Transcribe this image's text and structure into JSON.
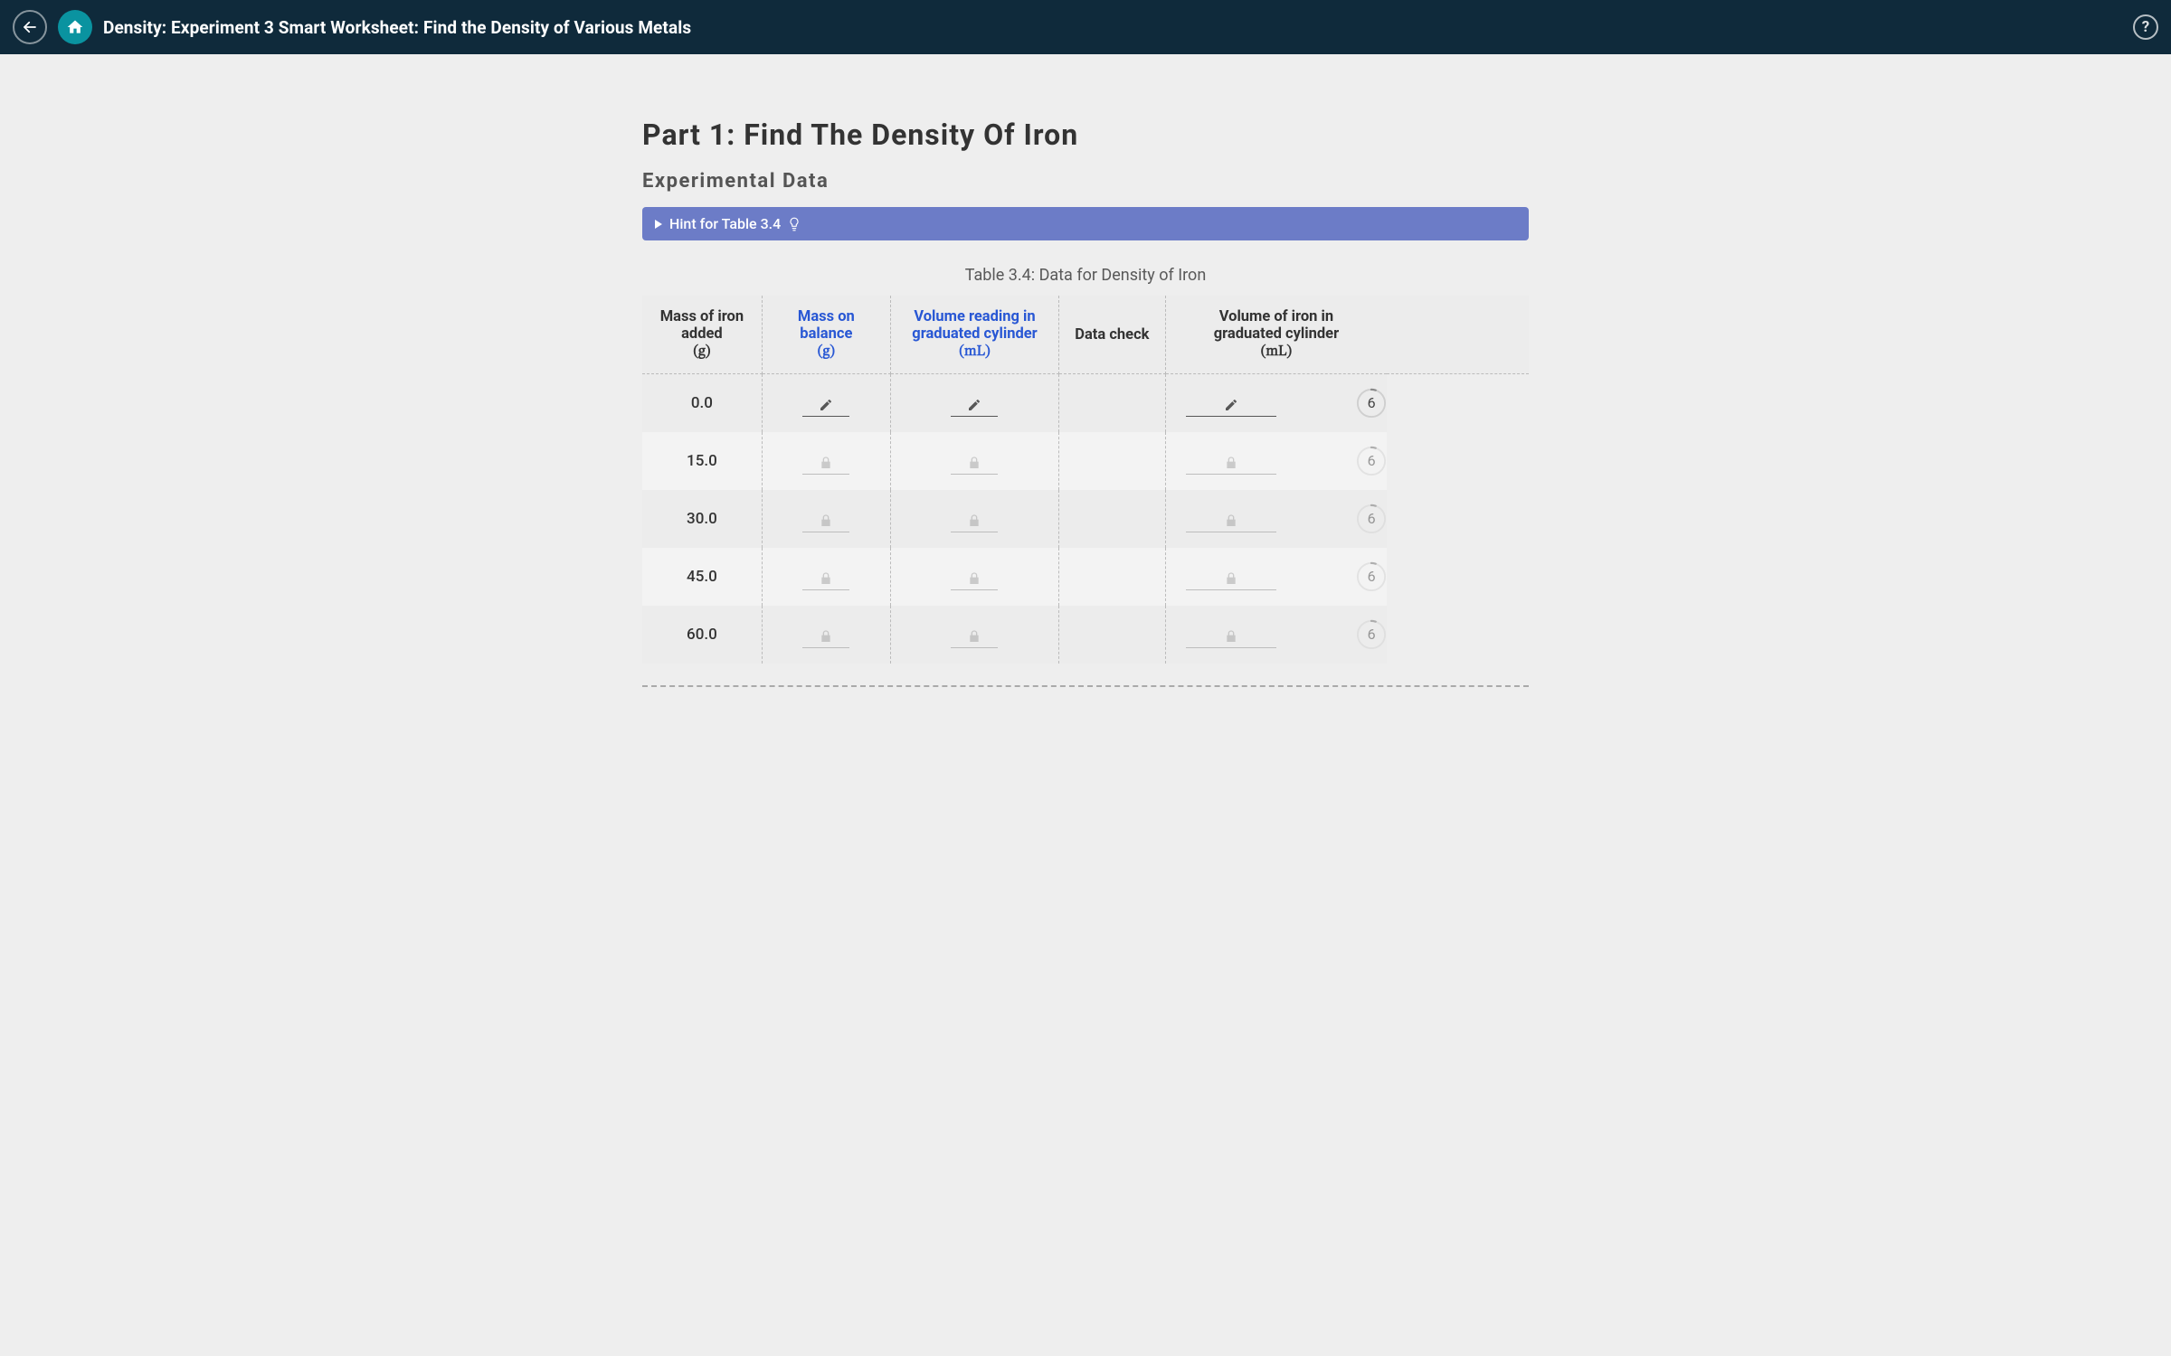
{
  "appbar": {
    "title": "Density: Experiment 3 Smart Worksheet: Find the Density of Various Metals",
    "help_label": "?",
    "back_icon": "arrow-left-icon",
    "home_icon": "home-icon"
  },
  "part_title": "Part 1: Find The Density Of Iron",
  "section_title": "Experimental Data",
  "hint": {
    "label": "Hint for Table 3.4"
  },
  "table": {
    "caption": "Table 3.4: Data for Density of Iron",
    "headers": {
      "col1_line1": "Mass of iron",
      "col1_line2": "added",
      "col1_unit": "(g)",
      "col2_line1": "Mass on",
      "col2_line2": "balance",
      "col2_unit": "(g)",
      "col3_line1": "Volume reading in",
      "col3_line2": "graduated cylinder",
      "col3_unit": "(mL)",
      "col4": "Data check",
      "col5_line1": "Volume of iron in",
      "col5_line2": "graduated cylinder",
      "col5_unit": "(mL)"
    },
    "rows": [
      {
        "mass_added": "0.0",
        "state": "editable",
        "attempts": "6"
      },
      {
        "mass_added": "15.0",
        "state": "locked",
        "attempts": "6"
      },
      {
        "mass_added": "30.0",
        "state": "locked",
        "attempts": "6"
      },
      {
        "mass_added": "45.0",
        "state": "locked",
        "attempts": "6"
      },
      {
        "mass_added": "60.0",
        "state": "locked",
        "attempts": "6"
      }
    ]
  }
}
